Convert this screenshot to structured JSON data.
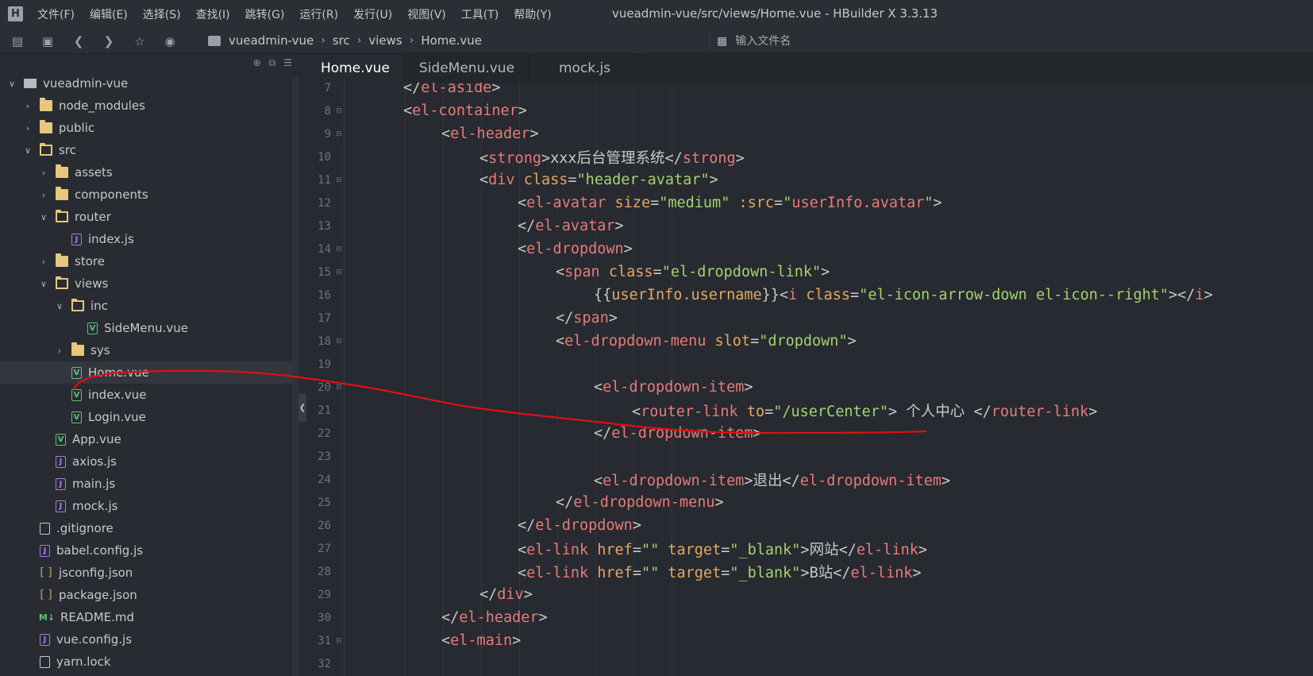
{
  "app": {
    "window_title": "vueadmin-vue/src/views/Home.vue - HBuilder X 3.3.13",
    "logo_glyph": "H"
  },
  "menu": [
    "文件(F)",
    "编辑(E)",
    "选择(S)",
    "查找(I)",
    "跳转(G)",
    "运行(R)",
    "发行(U)",
    "视图(V)",
    "工具(T)",
    "帮助(Y)"
  ],
  "toolbar": {
    "icons": [
      "new-file-icon",
      "save-icon",
      "back-icon",
      "forward-icon",
      "star-icon",
      "run-icon"
    ],
    "breadcrumb": [
      "vueadmin-vue",
      "src",
      "views",
      "Home.vue"
    ],
    "file_search_placeholder": "输入文件名"
  },
  "sidebar": {
    "tree": [
      {
        "label": "vueadmin-vue",
        "depth": 0,
        "icon": "root",
        "chevron": "open"
      },
      {
        "label": "node_modules",
        "depth": 1,
        "icon": "folder",
        "chevron": "closed"
      },
      {
        "label": "public",
        "depth": 1,
        "icon": "folder",
        "chevron": "closed"
      },
      {
        "label": "src",
        "depth": 1,
        "icon": "folder-open",
        "chevron": "open"
      },
      {
        "label": "assets",
        "depth": 2,
        "icon": "folder",
        "chevron": "closed"
      },
      {
        "label": "components",
        "depth": 2,
        "icon": "folder",
        "chevron": "closed"
      },
      {
        "label": "router",
        "depth": 2,
        "icon": "folder-open",
        "chevron": "open"
      },
      {
        "label": "index.js",
        "depth": 3,
        "icon": "js",
        "chevron": "none"
      },
      {
        "label": "store",
        "depth": 2,
        "icon": "folder",
        "chevron": "closed"
      },
      {
        "label": "views",
        "depth": 2,
        "icon": "folder-open",
        "chevron": "open"
      },
      {
        "label": "inc",
        "depth": 3,
        "icon": "folder-open",
        "chevron": "open"
      },
      {
        "label": "SideMenu.vue",
        "depth": 4,
        "icon": "vue",
        "chevron": "none"
      },
      {
        "label": "sys",
        "depth": 3,
        "icon": "folder",
        "chevron": "closed"
      },
      {
        "label": "Home.vue",
        "depth": 3,
        "icon": "vue",
        "chevron": "none",
        "selected": true
      },
      {
        "label": "index.vue",
        "depth": 3,
        "icon": "vue",
        "chevron": "none"
      },
      {
        "label": "Login.vue",
        "depth": 3,
        "icon": "vue",
        "chevron": "none"
      },
      {
        "label": "App.vue",
        "depth": 2,
        "icon": "vue",
        "chevron": "none"
      },
      {
        "label": "axios.js",
        "depth": 2,
        "icon": "js",
        "chevron": "none"
      },
      {
        "label": "main.js",
        "depth": 2,
        "icon": "js",
        "chevron": "none"
      },
      {
        "label": "mock.js",
        "depth": 2,
        "icon": "js",
        "chevron": "none"
      },
      {
        "label": ".gitignore",
        "depth": 1,
        "icon": "file",
        "chevron": "none"
      },
      {
        "label": "babel.config.js",
        "depth": 1,
        "icon": "js",
        "chevron": "none"
      },
      {
        "label": "jsconfig.json",
        "depth": 1,
        "icon": "json",
        "chevron": "none"
      },
      {
        "label": "package.json",
        "depth": 1,
        "icon": "json",
        "chevron": "none"
      },
      {
        "label": "README.md",
        "depth": 1,
        "icon": "md",
        "chevron": "none"
      },
      {
        "label": "vue.config.js",
        "depth": 1,
        "icon": "js",
        "chevron": "none"
      },
      {
        "label": "yarn.lock",
        "depth": 1,
        "icon": "file",
        "chevron": "none"
      }
    ]
  },
  "editor": {
    "tabs": [
      {
        "label": "Home.vue",
        "active": true
      },
      {
        "label": "SideMenu.vue",
        "active": false
      },
      {
        "label": "mock.js",
        "active": false
      }
    ],
    "lines": [
      {
        "n": "7",
        "fold": false,
        "indent": 2,
        "tokens": [
          [
            "p",
            "</"
          ],
          [
            "t",
            "el-aside"
          ],
          [
            "p",
            ">"
          ]
        ]
      },
      {
        "n": "8",
        "fold": true,
        "indent": 2,
        "tokens": [
          [
            "p",
            "<"
          ],
          [
            "t",
            "el-container"
          ],
          [
            "p",
            ">"
          ]
        ]
      },
      {
        "n": "9",
        "fold": true,
        "indent": 3,
        "tokens": [
          [
            "p",
            "<"
          ],
          [
            "t",
            "el-header"
          ],
          [
            "p",
            ">"
          ]
        ]
      },
      {
        "n": "10",
        "fold": false,
        "indent": 4,
        "tokens": [
          [
            "p",
            "<"
          ],
          [
            "t",
            "strong"
          ],
          [
            "p",
            ">"
          ],
          [
            "x",
            "xxx后台管理系统"
          ],
          [
            "p",
            "</"
          ],
          [
            "t",
            "strong"
          ],
          [
            "p",
            ">"
          ]
        ]
      },
      {
        "n": "11",
        "fold": true,
        "indent": 4,
        "tokens": [
          [
            "p",
            "<"
          ],
          [
            "t",
            "div"
          ],
          [
            "x",
            " "
          ],
          [
            "a",
            "class"
          ],
          [
            "p",
            "="
          ],
          [
            "s",
            "\"header-avatar\""
          ],
          [
            "p",
            ">"
          ]
        ]
      },
      {
        "n": "12",
        "fold": false,
        "indent": 5,
        "tokens": [
          [
            "p",
            "<"
          ],
          [
            "t",
            "el-avatar"
          ],
          [
            "x",
            " "
          ],
          [
            "a",
            "size"
          ],
          [
            "p",
            "="
          ],
          [
            "s",
            "\"medium\""
          ],
          [
            "x",
            " "
          ],
          [
            "a",
            ":src"
          ],
          [
            "p",
            "="
          ],
          [
            "s",
            "\""
          ],
          [
            "t",
            "userInfo.avatar"
          ],
          [
            "s",
            "\""
          ],
          [
            "p",
            ">"
          ]
        ]
      },
      {
        "n": "13",
        "fold": false,
        "indent": 5,
        "tokens": [
          [
            "p",
            "</"
          ],
          [
            "t",
            "el-avatar"
          ],
          [
            "p",
            ">"
          ]
        ]
      },
      {
        "n": "14",
        "fold": true,
        "indent": 5,
        "tokens": [
          [
            "p",
            "<"
          ],
          [
            "t",
            "el-dropdown"
          ],
          [
            "p",
            ">"
          ]
        ]
      },
      {
        "n": "15",
        "fold": true,
        "indent": 6,
        "tokens": [
          [
            "p",
            "<"
          ],
          [
            "t",
            "span"
          ],
          [
            "x",
            " "
          ],
          [
            "a",
            "class"
          ],
          [
            "p",
            "="
          ],
          [
            "s",
            "\"el-dropdown-link\""
          ],
          [
            "p",
            ">"
          ]
        ]
      },
      {
        "n": "16",
        "fold": false,
        "indent": 7,
        "tokens": [
          [
            "p",
            "{{"
          ],
          [
            "m",
            "userInfo.username"
          ],
          [
            "p",
            "}}<"
          ],
          [
            "t",
            "i"
          ],
          [
            "x",
            " "
          ],
          [
            "a",
            "class"
          ],
          [
            "p",
            "="
          ],
          [
            "s",
            "\"el-icon-arrow-down el-icon--right\""
          ],
          [
            "p",
            "></"
          ],
          [
            "t",
            "i"
          ],
          [
            "p",
            ">"
          ]
        ]
      },
      {
        "n": "17",
        "fold": false,
        "indent": 6,
        "tokens": [
          [
            "p",
            "</"
          ],
          [
            "t",
            "span"
          ],
          [
            "p",
            ">"
          ]
        ]
      },
      {
        "n": "18",
        "fold": true,
        "indent": 6,
        "tokens": [
          [
            "p",
            "<"
          ],
          [
            "t",
            "el-dropdown-menu"
          ],
          [
            "x",
            " "
          ],
          [
            "a",
            "slot"
          ],
          [
            "p",
            "="
          ],
          [
            "s",
            "\"dropdown\""
          ],
          [
            "p",
            ">"
          ]
        ]
      },
      {
        "n": "19",
        "fold": false,
        "indent": 0,
        "tokens": []
      },
      {
        "n": "20",
        "fold": true,
        "indent": 7,
        "tokens": [
          [
            "p",
            "<"
          ],
          [
            "t",
            "el-dropdown-item"
          ],
          [
            "p",
            ">"
          ]
        ]
      },
      {
        "n": "21",
        "fold": false,
        "indent": 8,
        "tokens": [
          [
            "p",
            "<"
          ],
          [
            "t",
            "router-link"
          ],
          [
            "x",
            " "
          ],
          [
            "a",
            "to"
          ],
          [
            "p",
            "="
          ],
          [
            "s",
            "\"/userCenter\""
          ],
          [
            "p",
            ">"
          ],
          [
            "x",
            " 个人中心 "
          ],
          [
            "p",
            "</"
          ],
          [
            "t",
            "router-link"
          ],
          [
            "p",
            ">"
          ]
        ]
      },
      {
        "n": "22",
        "fold": false,
        "indent": 7,
        "tokens": [
          [
            "p",
            "</"
          ],
          [
            "t",
            "el-dropdown-item"
          ],
          [
            "p",
            ">"
          ]
        ]
      },
      {
        "n": "23",
        "fold": false,
        "indent": 0,
        "tokens": []
      },
      {
        "n": "24",
        "fold": false,
        "indent": 7,
        "tokens": [
          [
            "p",
            "<"
          ],
          [
            "t",
            "el-dropdown-item"
          ],
          [
            "p",
            ">"
          ],
          [
            "x",
            "退出"
          ],
          [
            "p",
            "</"
          ],
          [
            "t",
            "el-dropdown-item"
          ],
          [
            "p",
            ">"
          ]
        ]
      },
      {
        "n": "25",
        "fold": false,
        "indent": 6,
        "tokens": [
          [
            "p",
            "</"
          ],
          [
            "t",
            "el-dropdown-menu"
          ],
          [
            "p",
            ">"
          ]
        ]
      },
      {
        "n": "26",
        "fold": false,
        "indent": 5,
        "tokens": [
          [
            "p",
            "</"
          ],
          [
            "t",
            "el-dropdown"
          ],
          [
            "p",
            ">"
          ]
        ]
      },
      {
        "n": "27",
        "fold": false,
        "indent": 5,
        "tokens": [
          [
            "p",
            "<"
          ],
          [
            "t",
            "el-link"
          ],
          [
            "x",
            " "
          ],
          [
            "a",
            "href"
          ],
          [
            "p",
            "="
          ],
          [
            "s",
            "\"\""
          ],
          [
            "x",
            " "
          ],
          [
            "a",
            "target"
          ],
          [
            "p",
            "="
          ],
          [
            "s",
            "\"_blank\""
          ],
          [
            "p",
            ">"
          ],
          [
            "x",
            "网站"
          ],
          [
            "p",
            "</"
          ],
          [
            "t",
            "el-link"
          ],
          [
            "p",
            ">"
          ]
        ]
      },
      {
        "n": "28",
        "fold": false,
        "indent": 5,
        "tokens": [
          [
            "p",
            "<"
          ],
          [
            "t",
            "el-link"
          ],
          [
            "x",
            " "
          ],
          [
            "a",
            "href"
          ],
          [
            "p",
            "="
          ],
          [
            "s",
            "\"\""
          ],
          [
            "x",
            " "
          ],
          [
            "a",
            "target"
          ],
          [
            "p",
            "="
          ],
          [
            "s",
            "\"_blank\""
          ],
          [
            "p",
            ">"
          ],
          [
            "x",
            "B站"
          ],
          [
            "p",
            "</"
          ],
          [
            "t",
            "el-link"
          ],
          [
            "p",
            ">"
          ]
        ]
      },
      {
        "n": "29",
        "fold": false,
        "indent": 4,
        "tokens": [
          [
            "p",
            "</"
          ],
          [
            "t",
            "div"
          ],
          [
            "p",
            ">"
          ]
        ]
      },
      {
        "n": "30",
        "fold": false,
        "indent": 3,
        "tokens": [
          [
            "p",
            "</"
          ],
          [
            "t",
            "el-header"
          ],
          [
            "p",
            ">"
          ]
        ]
      },
      {
        "n": "31",
        "fold": true,
        "indent": 3,
        "tokens": [
          [
            "p",
            "<"
          ],
          [
            "t",
            "el-main"
          ],
          [
            "p",
            ">"
          ]
        ]
      },
      {
        "n": "32",
        "fold": false,
        "indent": 0,
        "tokens": []
      }
    ]
  },
  "colors": {
    "tag": "#e87a7a",
    "attribute": "#e5a85f",
    "string": "#a5d36e",
    "text": "#c8c8c8",
    "annotation_stroke": "#e01010"
  }
}
